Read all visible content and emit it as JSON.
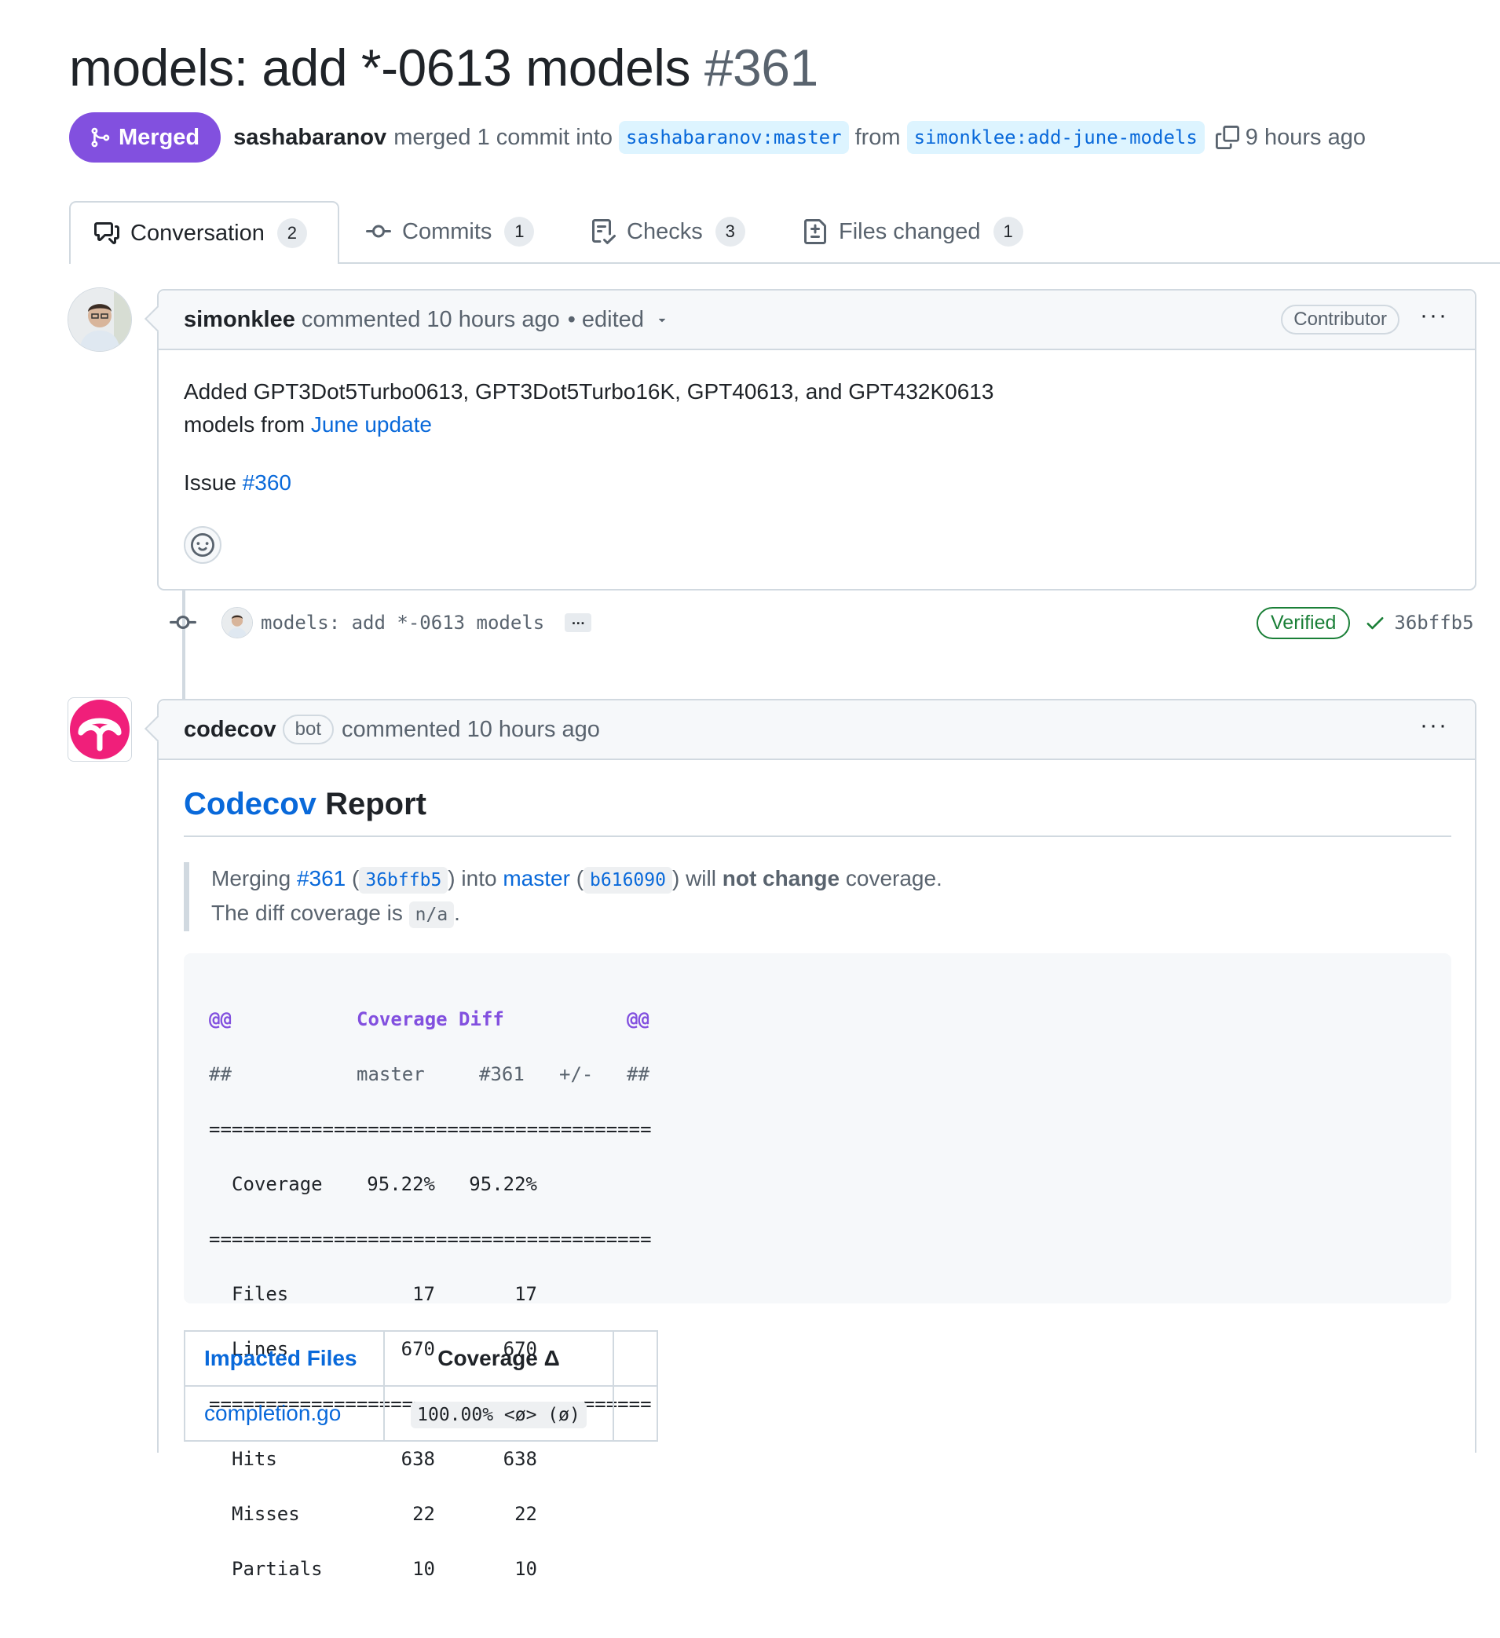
{
  "pr": {
    "title": "models: add *-0613 models",
    "number": "#361",
    "state_label": "Merged",
    "merged_by": "sashabaranov",
    "merge_text": "merged 1 commit into",
    "base_branch": "sashabaranov:master",
    "from_text": "from",
    "head_branch": "simonklee:add-june-models",
    "time": "9 hours ago"
  },
  "tabs": [
    {
      "label": "Conversation",
      "count": "2"
    },
    {
      "label": "Commits",
      "count": "1"
    },
    {
      "label": "Checks",
      "count": "3"
    },
    {
      "label": "Files changed",
      "count": "1"
    }
  ],
  "comment1": {
    "author": "simonklee",
    "action": "commented 10 hours ago",
    "edited": "• edited",
    "role": "Contributor",
    "line1": "Added GPT3Dot5Turbo0613, GPT3Dot5Turbo16K, GPT40613, and GPT432K0613",
    "line2_prefix": "models from",
    "line2_link": "June update",
    "issue_prefix": "Issue",
    "issue_link": "#360"
  },
  "commit": {
    "message": "models: add *-0613 models",
    "ellipsis": "…",
    "verified": "Verified",
    "sha": "36bffb5"
  },
  "comment2": {
    "author": "codecov",
    "bot": "bot",
    "action": "commented 10 hours ago",
    "heading_link": "Codecov",
    "heading_rest": "Report",
    "merging": "Merging",
    "pr_link": "#361",
    "head_sha": "36bffb5",
    "into": "into",
    "base_link": "master",
    "base_sha": "b616090",
    "will": "will",
    "not_change": "not change",
    "coverage_word": "coverage.",
    "diff_text": "The diff coverage is",
    "diff_value": "n/a",
    "diff_end": "."
  },
  "coverage_diff": {
    "header_at_left": "@@",
    "header_title": "Coverage Diff",
    "header_at_right": "@@",
    "cols_left": "##",
    "col_master": "master",
    "col_pr": "#361",
    "col_delta": "+/-",
    "cols_right": "##",
    "separator": "=======================================",
    "rows_a": [
      {
        "label": "Coverage",
        "master": "95.22%",
        "pr": "95.22%"
      }
    ],
    "rows_b": [
      {
        "label": "Files",
        "master": "17",
        "pr": "17"
      },
      {
        "label": "Lines",
        "master": "670",
        "pr": "670"
      }
    ],
    "rows_c": [
      {
        "label": "Hits",
        "master": "638",
        "pr": "638"
      },
      {
        "label": "Misses",
        "master": "22",
        "pr": "22"
      },
      {
        "label": "Partials",
        "master": "10",
        "pr": "10"
      }
    ]
  },
  "impacted": {
    "col1": "Impacted Files",
    "col2": "Coverage Δ",
    "col3": "",
    "rows": [
      {
        "file": "completion.go",
        "coverage": "100.00% <ø> (ø)",
        "extra": ""
      }
    ]
  },
  "colors": {
    "merged": "#8250df",
    "link": "#0969da",
    "verified": "#1a7f37",
    "codecov": "#f01f7a"
  }
}
